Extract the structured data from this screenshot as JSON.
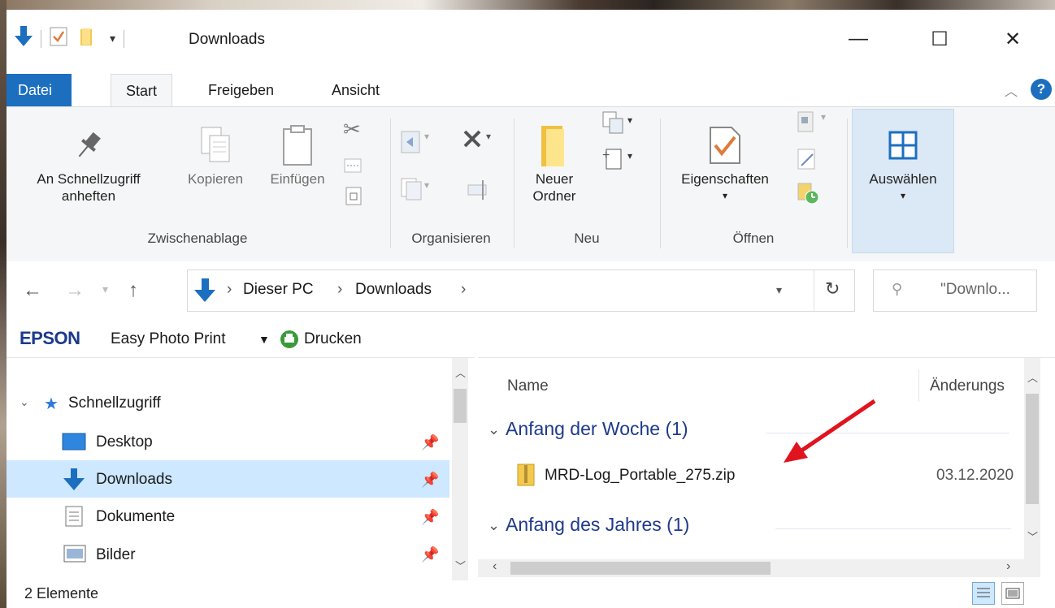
{
  "window": {
    "title": "Downloads",
    "controls": [
      "—",
      "☐",
      "✕"
    ]
  },
  "tabs": [
    {
      "label": "Datei",
      "active": false
    },
    {
      "label": "Start",
      "active": true
    },
    {
      "label": "Freigeben",
      "active": false
    },
    {
      "label": "Ansicht",
      "active": false
    }
  ],
  "ribbon": {
    "pin_label_1": "An Schnellzugriff",
    "pin_label_2": "anheften",
    "copy_label": "Kopieren",
    "paste_label": "Einfügen",
    "newfolder_label_1": "Neuer",
    "newfolder_label_2": "Ordner",
    "properties_label": "Eigenschaften",
    "select_label": "Auswählen",
    "groups": {
      "clipboard": "Zwischenablage",
      "organize": "Organisieren",
      "new": "Neu",
      "open": "Öffnen"
    },
    "colors": {
      "datei": "#1c6fbf",
      "selected": "#cde8ff"
    }
  },
  "address": {
    "crumbs": [
      "Dieser PC",
      "Downloads"
    ],
    "separator": "›",
    "search_placeholder": "\"Downlo..."
  },
  "epson": {
    "brand": "EPSON",
    "app": "Easy Photo Print",
    "print": "Drucken"
  },
  "navpane": {
    "quick_access": "Schnellzugriff",
    "items": [
      {
        "label": "Desktop",
        "icon": "desktop-icon",
        "selected": false
      },
      {
        "label": "Downloads",
        "icon": "download-arrow-icon",
        "selected": true
      },
      {
        "label": "Dokumente",
        "icon": "documents-icon",
        "selected": false
      },
      {
        "label": "Bilder",
        "icon": "pictures-icon",
        "selected": false
      }
    ]
  },
  "filepane": {
    "columns": [
      "Name",
      "Änderungs"
    ],
    "groups": [
      {
        "label": "Anfang der Woche (1)",
        "files": [
          {
            "name": "MRD-Log_Portable_275.zip",
            "date": "03.12.2020"
          }
        ]
      },
      {
        "label": "Anfang des Jahres (1)",
        "files": []
      }
    ]
  },
  "status": {
    "count": "2 Elemente"
  }
}
